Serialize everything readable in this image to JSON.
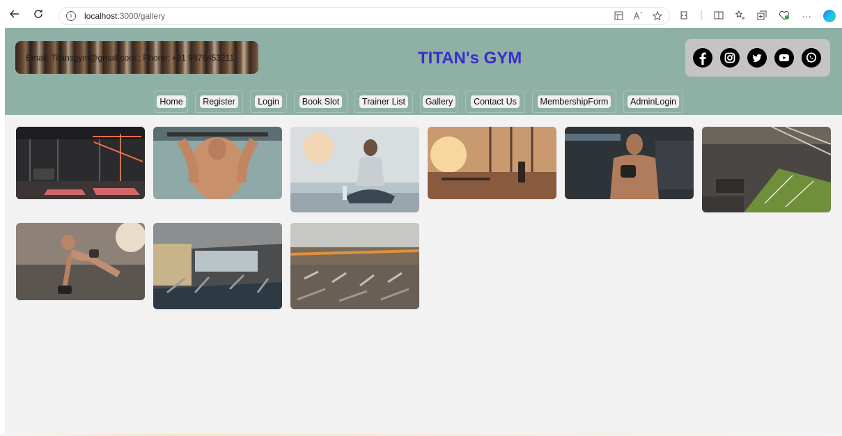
{
  "browser": {
    "url_host": "localhost",
    "url_path": ":3000/gallery",
    "info_glyph": "i",
    "ellipsis": "···"
  },
  "header": {
    "contact_text": "Email: Titansgym@gmail.com ; Phone: +91 9876453211",
    "brand": "TITAN's GYM",
    "social_icons": [
      "facebook-icon",
      "instagram-icon",
      "twitter-icon",
      "youtube-icon",
      "whatsapp-icon"
    ]
  },
  "nav": {
    "items": [
      "Home",
      "Register",
      "Login",
      "Book Slot",
      "Trainer List",
      "Gallery",
      "Contact Us",
      "MembershipForm",
      "AdminLogin"
    ]
  },
  "gallery": {
    "images": [
      "gym interior with red lights",
      "man doing lat pulldown",
      "woman meditating",
      "sunlit gym hall",
      "man holding dumbbell",
      "gym with turf lane",
      "man doing push-up with dumbbells",
      "warehouse gym with machines",
      "large gym floor"
    ]
  },
  "colors": {
    "header_bg": "#8fb1a5",
    "brand": "#3a2ccd",
    "page_bg": "#f2f2f2",
    "social_box": "#c4c4c4"
  }
}
